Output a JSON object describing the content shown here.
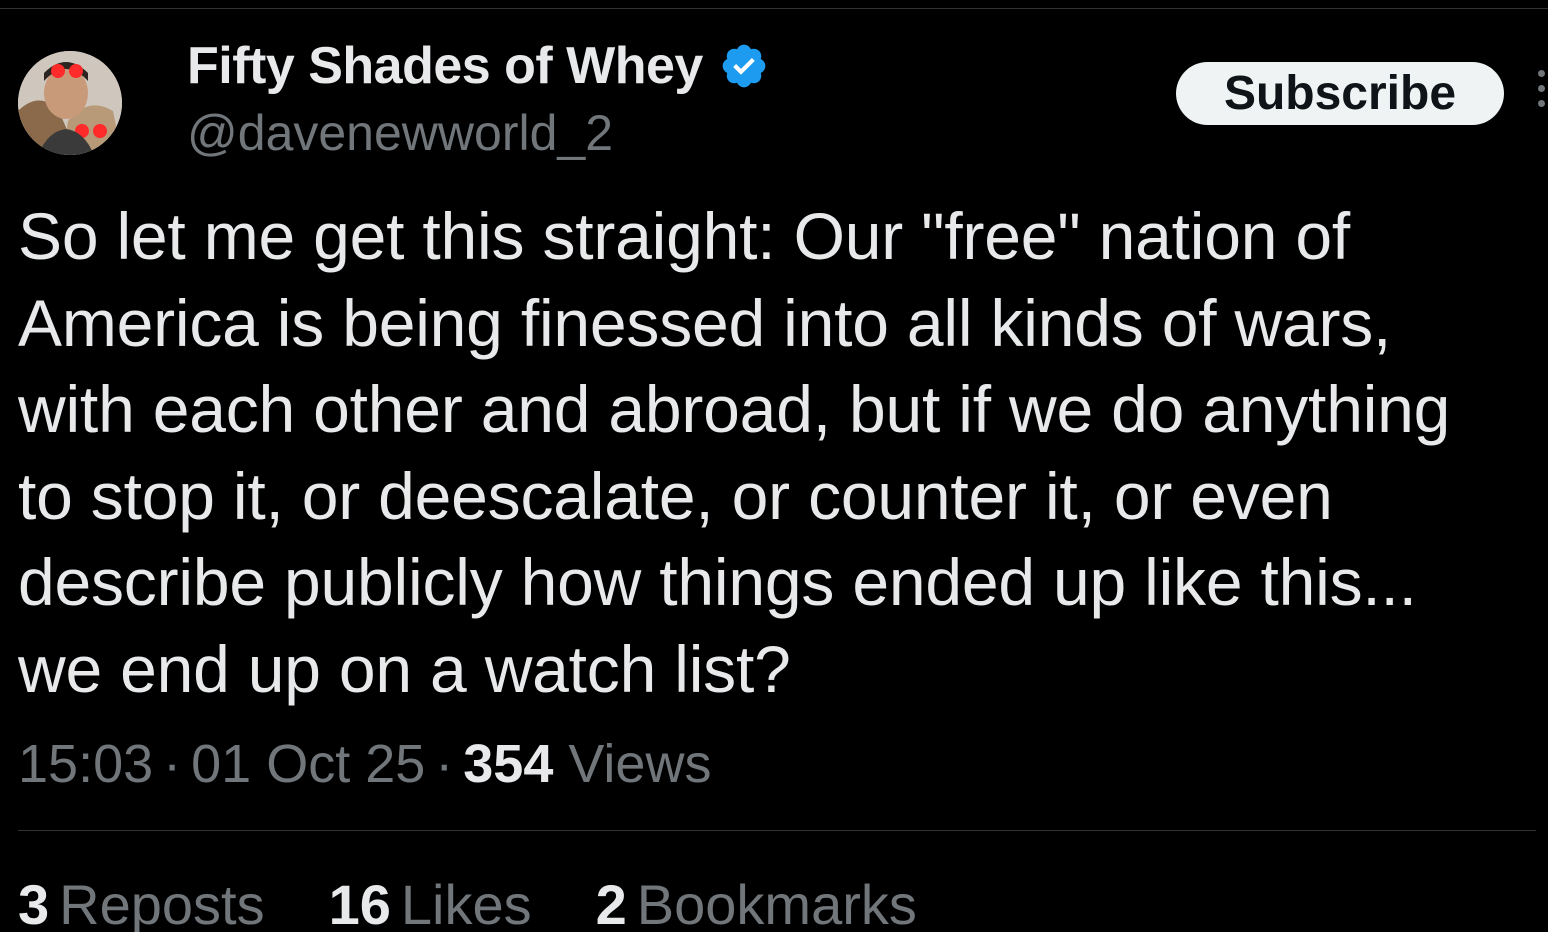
{
  "author": {
    "name": "Fifty Shades of Whey",
    "handle": "@davenewworld_2",
    "verified": true,
    "verified_color": "#1d9bf0"
  },
  "actions": {
    "subscribe_label": "Subscribe"
  },
  "tweet": {
    "text": "So let me get this straight: Our \"free\" nation of\nAmerica is being finessed into all kinds of wars,\nwith each other and abroad, but if we do anything\nto stop it, or deescalate, or counter it, or even\ndescribe publicly how things ended up like this...\nwe end up on a watch list?",
    "time": "15:03",
    "date": "01 Oct 25",
    "separator": "·",
    "views_count": "354",
    "views_label": "Views"
  },
  "stats": {
    "reposts_count": "3",
    "reposts_label": "Reposts",
    "likes_count": "16",
    "likes_label": "Likes",
    "bookmarks_count": "2",
    "bookmarks_label": "Bookmarks"
  },
  "icons": {
    "avatar": "avatar-image",
    "verified": "verified-badge-icon",
    "more": "more-options-icon"
  },
  "colors": {
    "background": "#000000",
    "text_primary": "#e7e9ea",
    "text_secondary": "#71767b",
    "button_bg": "#eff3f4"
  }
}
